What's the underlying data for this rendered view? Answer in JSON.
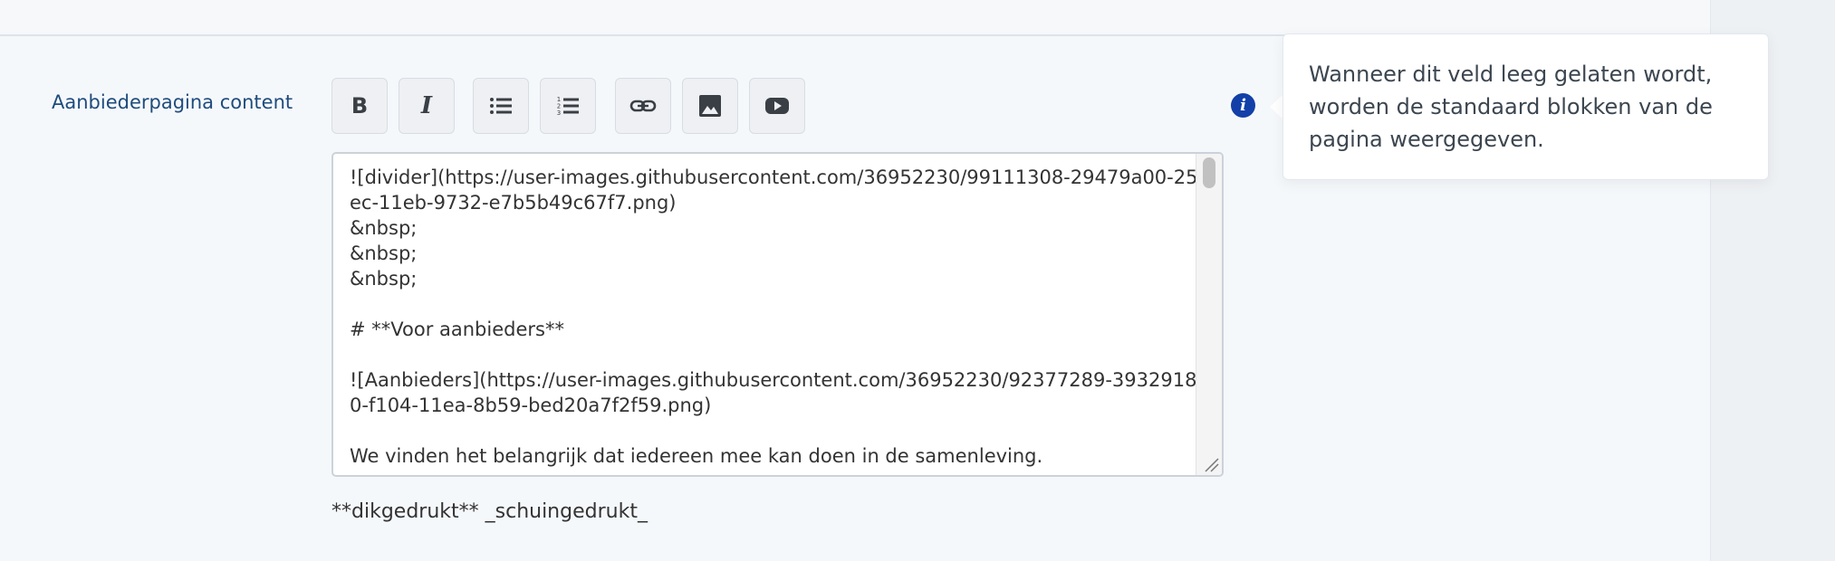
{
  "form": {
    "field_label": "Aanbiederpagina content",
    "hint": "**dikgedrukt** _schuingedrukt_"
  },
  "toolbar": {
    "buttons": [
      {
        "icon": "bold-icon",
        "label": "B"
      },
      {
        "icon": "italic-icon",
        "label": "I"
      },
      {
        "icon": "bulleted-list-icon"
      },
      {
        "icon": "numbered-list-icon"
      },
      {
        "icon": "link-icon"
      },
      {
        "icon": "image-icon"
      },
      {
        "icon": "youtube-icon"
      }
    ]
  },
  "editor": {
    "content": "![divider](https://user-images.githubusercontent.com/36952230/99111308-29479a00-25ec-11eb-9732-e7b5b49c67f7.png)\n&nbsp;\n&nbsp;\n&nbsp;\n\n# **Voor aanbieders**\n\n![Aanbieders](https://user-images.githubusercontent.com/36952230/92377289-39329180-f104-11ea-8b59-bed20a7f2f59.png)\n\nWe vinden het belangrijk dat iedereen mee kan doen in de samenleving."
  },
  "tooltip": {
    "text": "Wanneer dit veld leeg gelaten wordt, worden de standaard blokken van de pagina weergegeven."
  },
  "colors": {
    "label": "#1e4c7d",
    "info_icon": "#1240a8",
    "background": "#f5f8fb"
  }
}
